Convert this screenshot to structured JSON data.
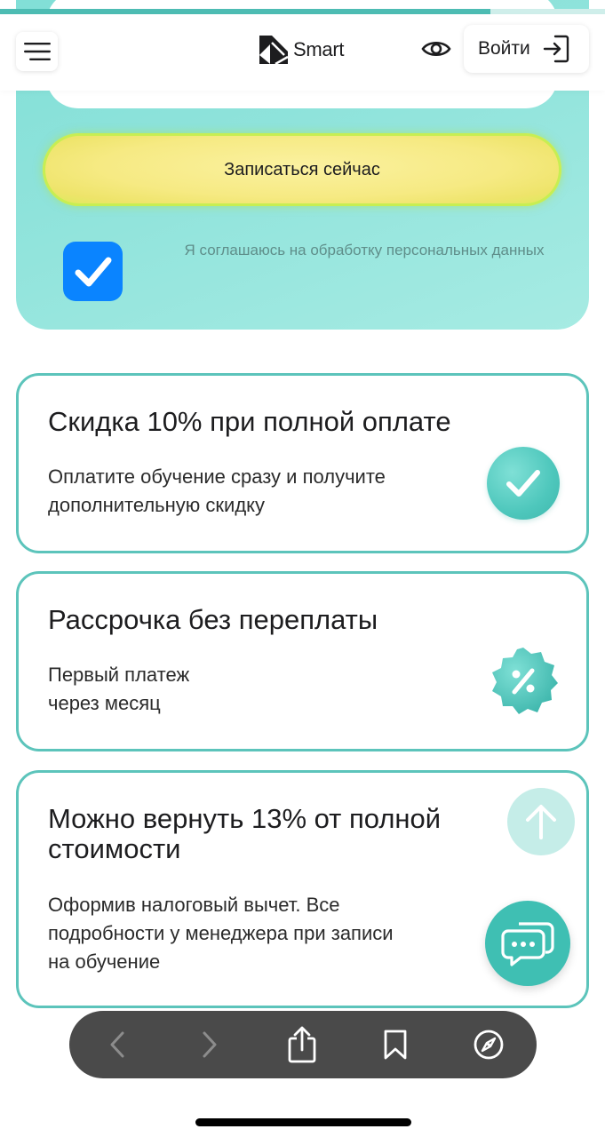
{
  "header": {
    "logo_text": "Smart",
    "login_label": "Войти",
    "progress": 0.81
  },
  "form": {
    "signup_label": "Записаться сейчас",
    "consent_text": "Я соглашаюсь на обработку персональных данных",
    "consent_checked": true
  },
  "features": [
    {
      "title": "Скидка 10% при полной оплате",
      "description_lines": [
        "Оплатите обучение сразу и получите",
        "дополнительную скидку"
      ],
      "icon": "check-icon"
    },
    {
      "title": "Рассрочка без переплаты",
      "description_lines": [
        "Первый платеж",
        "через месяц"
      ],
      "icon": "percent-badge-icon"
    },
    {
      "title_lines": [
        "Можно вернуть 13% от полной",
        "стоимости"
      ],
      "description_lines": [
        "Оформив налоговый вычет. Все",
        "подробности у менеджера при записи",
        "на обучение"
      ],
      "icon": "none"
    }
  ],
  "colors": {
    "accent": "#4ec7bc",
    "card_border": "#5cc4bb",
    "checkbox": "#0a84ff",
    "button_yellow": "#f6ea83"
  }
}
